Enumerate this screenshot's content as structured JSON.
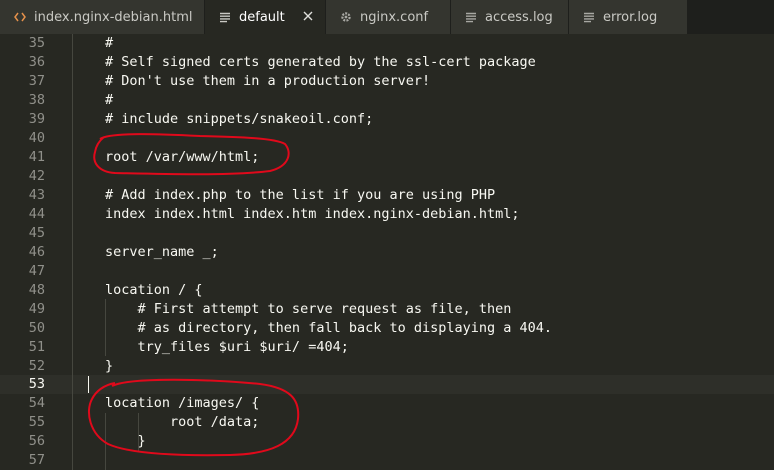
{
  "tabs": [
    {
      "label": "index.nginx-debian.html",
      "icon": "code-icon",
      "active": false
    },
    {
      "label": "default",
      "icon": "document-lines-icon",
      "active": true
    },
    {
      "label": "nginx.conf",
      "icon": "gear-icon",
      "active": false
    },
    {
      "label": "access.log",
      "icon": "document-lines-icon",
      "active": false
    },
    {
      "label": "error.log",
      "icon": "document-lines-icon",
      "active": false
    }
  ],
  "colors": {
    "background": "#272822",
    "tab_inactive": "#34352f",
    "tab_bar": "#1e1f1c",
    "foreground": "#f8f8f2",
    "line_number": "#90908a",
    "annotation": "#e0091b",
    "tab_icon_accent": "#e5914b"
  },
  "editor": {
    "current_line": "53",
    "lines": [
      {
        "num": "35",
        "text": "#"
      },
      {
        "num": "36",
        "text": "# Self signed certs generated by the ssl-cert package"
      },
      {
        "num": "37",
        "text": "# Don't use them in a production server!"
      },
      {
        "num": "38",
        "text": "#"
      },
      {
        "num": "39",
        "text": "# include snippets/snakeoil.conf;"
      },
      {
        "num": "40",
        "text": ""
      },
      {
        "num": "41",
        "text": "root /var/www/html;"
      },
      {
        "num": "42",
        "text": ""
      },
      {
        "num": "43",
        "text": "# Add index.php to the list if you are using PHP"
      },
      {
        "num": "44",
        "text": "index index.html index.htm index.nginx-debian.html;"
      },
      {
        "num": "45",
        "text": ""
      },
      {
        "num": "46",
        "text": "server_name _;"
      },
      {
        "num": "47",
        "text": ""
      },
      {
        "num": "48",
        "text": "location / {"
      },
      {
        "num": "49",
        "text": "    # First attempt to serve request as file, then"
      },
      {
        "num": "50",
        "text": "    # as directory, then fall back to displaying a 404."
      },
      {
        "num": "51",
        "text": "    try_files $uri $uri/ =404;"
      },
      {
        "num": "52",
        "text": "}"
      },
      {
        "num": "53",
        "text": ""
      },
      {
        "num": "54",
        "text": "location /images/ {"
      },
      {
        "num": "55",
        "text": "        root /data;"
      },
      {
        "num": "56",
        "text": "    }"
      },
      {
        "num": "57",
        "text": ""
      }
    ]
  }
}
